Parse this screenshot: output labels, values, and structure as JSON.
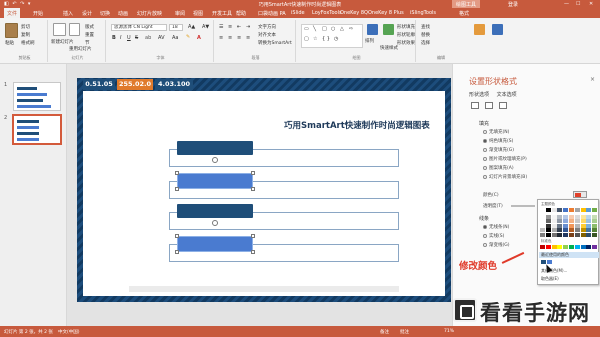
{
  "window": {
    "title": "巧用SmartArt快速制作时尚逻辑图表",
    "context_tab": "绘图工具",
    "user": "登录",
    "quick_access": "◧ ↶ ↷ ▾"
  },
  "tabs": [
    {
      "label": "文件",
      "active": true
    },
    {
      "label": "开始"
    },
    {
      "label": "插入"
    },
    {
      "label": "设计"
    },
    {
      "label": "切换"
    },
    {
      "label": "动画"
    },
    {
      "label": "幻灯片放映"
    },
    {
      "label": "审阅"
    },
    {
      "label": "视图"
    },
    {
      "label": "开发工具"
    },
    {
      "label": "帮助"
    },
    {
      "label": "口袋动画 PA"
    },
    {
      "label": "iSlide"
    },
    {
      "label": "LoyFoxTools"
    },
    {
      "label": "OneKey 8Q"
    },
    {
      "label": "OneKey 8 Plus"
    },
    {
      "label": "iSlingTools"
    },
    {
      "label": "格式"
    }
  ],
  "ribbon": {
    "clipboard": {
      "paste": "粘贴",
      "cut": "剪切",
      "copy": "复制",
      "format_painter": "格式刷",
      "group_label": "剪贴板"
    },
    "slides": {
      "new_slide": "新建幻灯片",
      "reuse": "重用幻灯片",
      "layout": "版式",
      "reset": "重置",
      "section": "节",
      "group_label": "幻灯片"
    },
    "font": {
      "font_name": "思源黑体 CN Light",
      "font_size": "18",
      "bold": "B",
      "italic": "I",
      "underline": "U",
      "strike": "S",
      "group_label": "字体"
    },
    "paragraph": {
      "text_direction": "文字方向",
      "align_text": "对齐文本",
      "to_smartart": "转换为SmartArt",
      "group_label": "段落"
    },
    "drawing": {
      "arrange": "排列",
      "quick_styles": "快速样式",
      "shape_fill": "形状填充",
      "shape_outline": "形状轮廓",
      "shape_effects": "形状效果",
      "group_label": "绘图"
    },
    "editing": {
      "find": "查找",
      "replace": "替换",
      "select": "选择",
      "group_label": "编辑"
    }
  },
  "slides_panel": {
    "items": [
      {
        "number": "1",
        "selected": false
      },
      {
        "number": "2",
        "selected": true
      }
    ]
  },
  "slide": {
    "badges": [
      "0.51.05",
      "255.02.0",
      "4.03.100"
    ],
    "title": "巧用SmartArt快速制作时尚逻辑图表"
  },
  "format_pane": {
    "title": "设置形状格式",
    "tabs": [
      "形状选项",
      "文本选项"
    ],
    "close": "×",
    "fill_section": "填充",
    "fill_options": [
      "无填充(N)",
      "纯色填充(S)",
      "渐变填充(G)",
      "图片或纹理填充(P)",
      "图案填充(A)",
      "幻灯片背景填充(B)"
    ],
    "color_label": "颜色(C)",
    "transparency_label": "透明度(T)",
    "line_section": "线条",
    "line_options": [
      "无线条(N)",
      "实线(S)",
      "渐变线(G)"
    ]
  },
  "color_palette": {
    "theme_title": "主题颜色",
    "standard_title": "标准色",
    "recent_label": "最近使用的颜色",
    "more_colors": "其他颜色(M)...",
    "eyedropper": "取色器(E)",
    "theme_colors": [
      "#ffffff",
      "#000000",
      "#e7e6e6",
      "#44546a",
      "#4472c4",
      "#ed7d31",
      "#a5a5a5",
      "#ffc000",
      "#5b9bd5",
      "#70ad47"
    ],
    "standard_colors": [
      "#c00000",
      "#ff0000",
      "#ffc000",
      "#ffff00",
      "#92d050",
      "#00b050",
      "#00b0f0",
      "#0070c0",
      "#002060",
      "#7030a0"
    ],
    "recent_colors": [
      "#1f4e79",
      "#4a7bd0"
    ]
  },
  "annotation": "修改颜色",
  "status_bar": {
    "slide_info": "幻灯片 第 2 张，共 2 张",
    "language": "中文(中国)",
    "notes": "备注",
    "comments": "批注",
    "zoom": "71%"
  },
  "watermark": "看看手游网"
}
